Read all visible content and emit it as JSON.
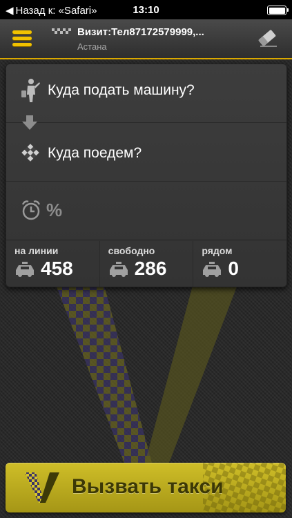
{
  "status_bar": {
    "back_label": "Назад к: «Safari»",
    "time": "13:10"
  },
  "header": {
    "title": "Визит:Тел87172579999,...",
    "subtitle": "Астана"
  },
  "route": {
    "from_placeholder": "Куда подать машину?",
    "to_placeholder": "Куда поедем?",
    "time_value": "%"
  },
  "stats": {
    "online_label": "на линии",
    "online_value": "458",
    "free_label": "свободно",
    "free_value": "286",
    "nearby_label": "рядом",
    "nearby_value": "0"
  },
  "call_button": {
    "label": "Вызвать такси"
  },
  "colors": {
    "accent": "#f2c200",
    "button": "#c2b21f"
  }
}
